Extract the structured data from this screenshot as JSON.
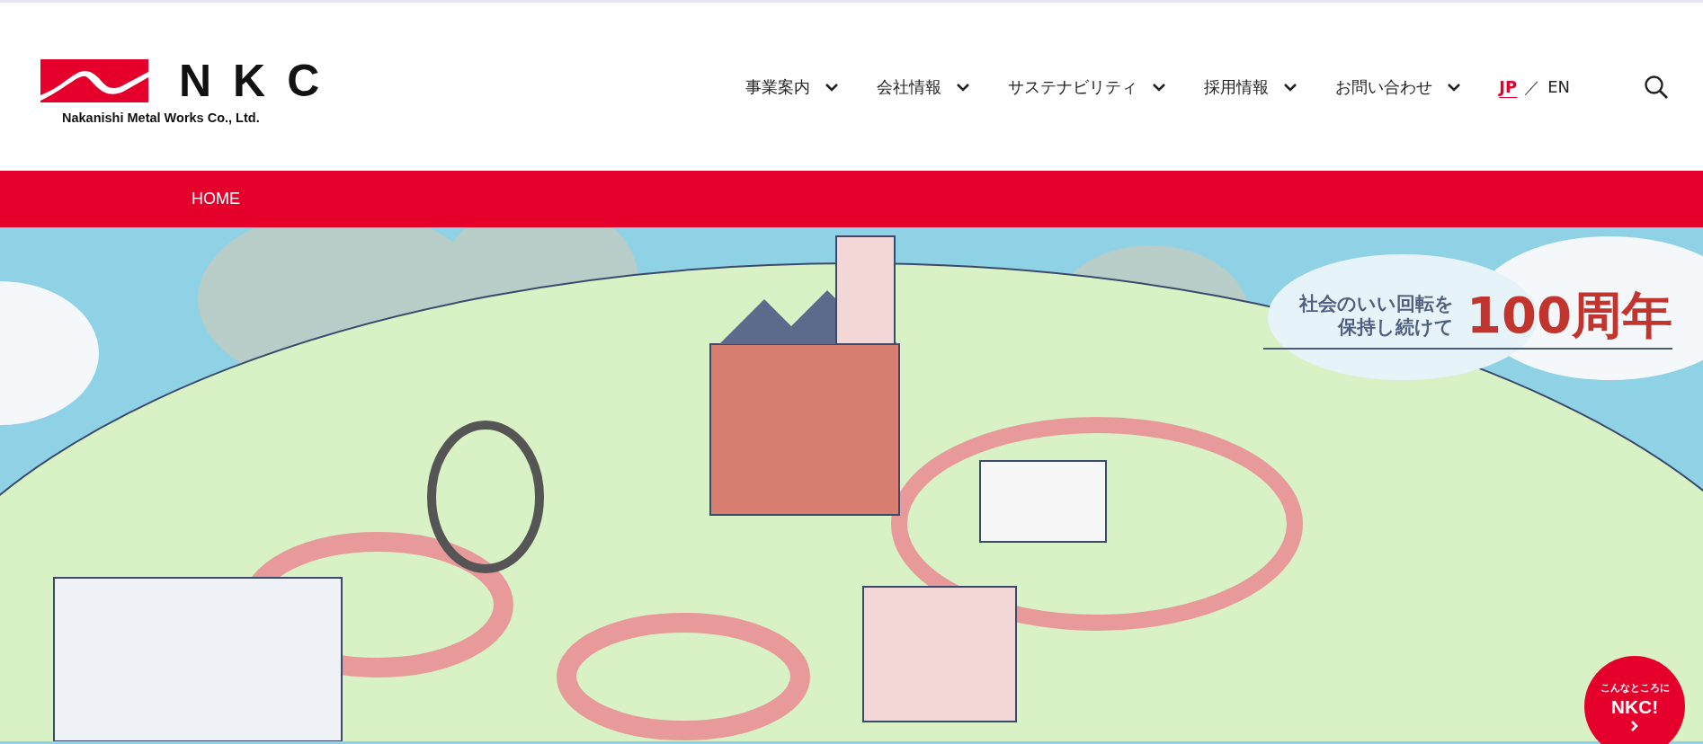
{
  "header": {
    "logo": {
      "mark": "NKC",
      "company": "Nakanishi Metal Works Co., Ltd."
    },
    "nav": [
      {
        "label": "事業案内"
      },
      {
        "label": "会社情報"
      },
      {
        "label": "サステナビリティ"
      },
      {
        "label": "採用情報"
      },
      {
        "label": "お問い合わせ"
      }
    ],
    "languages": [
      {
        "label": "JP",
        "selected": true
      },
      {
        "label": "EN",
        "selected": false
      }
    ],
    "language_separator": "／"
  },
  "breadcrumb": "HOME",
  "hero": {
    "headline_lines": [
      "社会のいい回転を",
      "保持し続けて"
    ],
    "anniversary": "100周年",
    "badge": {
      "caption": "こんなところに",
      "title": "NKC!"
    }
  }
}
